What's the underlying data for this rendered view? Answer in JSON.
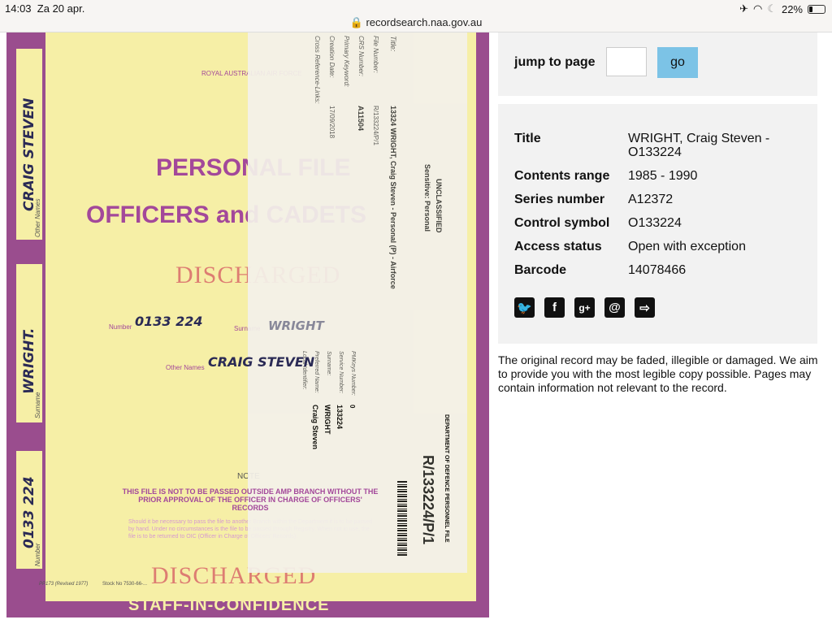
{
  "status_bar": {
    "time": "14:03",
    "date": "Za 20 apr.",
    "url": "recordsearch.naa.gov.au",
    "battery": "22%",
    "battery_level": 0.22
  },
  "document": {
    "tab1": "CRAIG STEVEN",
    "tab2": "WRIGHT.",
    "tab3": "0133 224",
    "tab_label_other": "Other Names",
    "tab_label_surname": "Surname",
    "tab_label_number": "Number",
    "header": "ROYAL AUSTRALIAN AIR FORCE",
    "line1": "PERSONAL FILE",
    "line2": "OFFICERS and CADETS",
    "stamp": "DISCHARGED",
    "number_label": "Number",
    "number_value": "0133 224",
    "surname_label": "Surname",
    "surname_value": "WRIGHT",
    "other_label": "Other Names",
    "other_value": "CRAIG STEVEN",
    "note_title": "NOTE",
    "note_bold": "THIS FILE IS NOT TO BE PASSED OUTSIDE AMP BRANCH WITHOUT THE PRIOR APPROVAL OF THE OFFICER IN CHARGE OF OFFICERS' RECORDS",
    "note_text": "Should it be necessary to pass the file to another Branch within the Department it is to be passed by hand. Under no circumstances is the file to be passed through Registry. When not in use, the file is to be returned to OIC (Officer in Charge of Officers' Records).",
    "form_no": "PP173 (Revised 1977)",
    "stock_no": "Stock No 7530-66-...",
    "footer": "STAFF-IN-CONFIDENCE",
    "cover": {
      "classification": "UNCLASSIFIED",
      "sensitive": "Sensitive: Personal",
      "fields": [
        {
          "label": "Title:",
          "value": "13324 WRIGHT, Craig Steven - Personal (P) - Airforce"
        },
        {
          "label": "File Number:",
          "value": "R/133224/P/1"
        },
        {
          "label": "CRS Number:",
          "value": "A11504"
        },
        {
          "label": "Primary Keyword:",
          "value": ""
        },
        {
          "label": "Creation Date:",
          "value": "17/09/2018"
        },
        {
          "label": "Cross Reference-Links:",
          "value": ""
        }
      ],
      "pmkeys_label": "PMKeys Number:",
      "pmkeys": "0",
      "service_label": "Service Number:",
      "service": "133224",
      "surname_label": "Surname:",
      "surname": "WRIGHT",
      "preferred_label": "Preferred Name:",
      "preferred": "Craig Steven",
      "local_label": "Local Identifier:",
      "dept": "DEPARTMENT OF DEFENCE PERSONNEL FILE",
      "file_no": "R/133224/P/1"
    }
  },
  "jump": {
    "label": "jump to page",
    "value": "",
    "go": "go"
  },
  "info": [
    {
      "k": "Title",
      "v": "WRIGHT, Craig Steven - O133224"
    },
    {
      "k": "Contents range",
      "v": "1985 - 1990"
    },
    {
      "k": "Series number",
      "v": "A12372"
    },
    {
      "k": "Control symbol",
      "v": "O133224"
    },
    {
      "k": "Access status",
      "v": "Open with exception"
    },
    {
      "k": "Barcode",
      "v": "14078466"
    }
  ],
  "share_icons": [
    "twitter-icon",
    "facebook-icon",
    "google-plus-icon",
    "email-icon",
    "export-icon"
  ],
  "notice": "The original record may be faded, illegible or damaged. We aim to provide you with the most legible copy possible. Pages may contain information not relevant to the record."
}
